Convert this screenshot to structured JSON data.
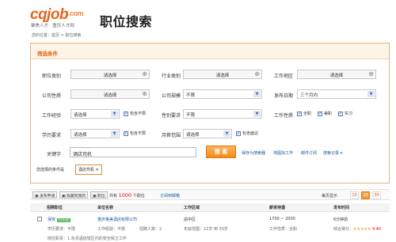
{
  "header": {
    "logo": "cqjob",
    "logo_domain": ".com",
    "tagline": "聚焦人才 · 重庆人才网",
    "title": "职位搜索"
  },
  "breadcrumb": "您的位置：首页 > 职位搜索",
  "filter": {
    "title": "筛选条件",
    "rows": [
      {
        "label": "职位类别",
        "value": "请选择"
      },
      {
        "label": "行业类别",
        "value": "请选择"
      },
      {
        "label": "工作地区",
        "value": "请选择"
      },
      {
        "label": "公司性质",
        "value": "请选择"
      },
      {
        "label": "公司规模",
        "value": "不限"
      },
      {
        "label": "发布日期",
        "value": "三个月内"
      },
      {
        "label": "工作经验",
        "value": "请选择"
      },
      {
        "label": "性别要求",
        "value": "不限"
      },
      {
        "label": "工作性质",
        "value": ""
      },
      {
        "label": "学历要求",
        "value": "请选择"
      },
      {
        "label": "月薪范围",
        "value": "请选择"
      }
    ],
    "include_unlimited": "包含不限",
    "include_negotiable": "包含面议",
    "job_types": [
      "全职",
      "兼职",
      "实习"
    ],
    "keyword_label": "关键字",
    "keyword_value": "酒店司机",
    "search_button": "搜 索",
    "links": [
      "保存为搜索器",
      "地图找工作",
      "邮件订阅",
      "搜索记录 ▾"
    ],
    "selected_label": "您选择的条件是",
    "selected_tag": "酒店司机 ✕"
  },
  "toolbar": {
    "apply": "发布申请",
    "favorite": "收藏到我的",
    "compare": "职位",
    "total_prefix": "共有",
    "total_count": "1000",
    "total_suffix": "个职位",
    "subscribe": "订阅到邮箱",
    "per_page_label": "每页显示",
    "pages": [
      "10",
      "20",
      "30"
    ]
  },
  "table": {
    "headers": [
      "招聘职位",
      "单位名称",
      "工作区域",
      "薪资待遇",
      "发布时间"
    ]
  },
  "row1": {
    "title": "保安",
    "badge": "已认证",
    "company": "重庆格美酒店有限公司",
    "area": "渝中区",
    "salary": "1700 ~ 2000",
    "time": "6分钟前"
  },
  "row2": {
    "edu": "学历要求：不限",
    "exp": "工作经验：不限",
    "count": "招聘人数：2",
    "age": "年龄范围：22岁 到 35岁",
    "nature": "工作性质：全职",
    "rating": "综合得分：",
    "stars": "★★★★★",
    "score": "4.40"
  },
  "row3": {
    "desc": "岗位职责：1.负责酒店辖区内的安全保卫工作"
  }
}
